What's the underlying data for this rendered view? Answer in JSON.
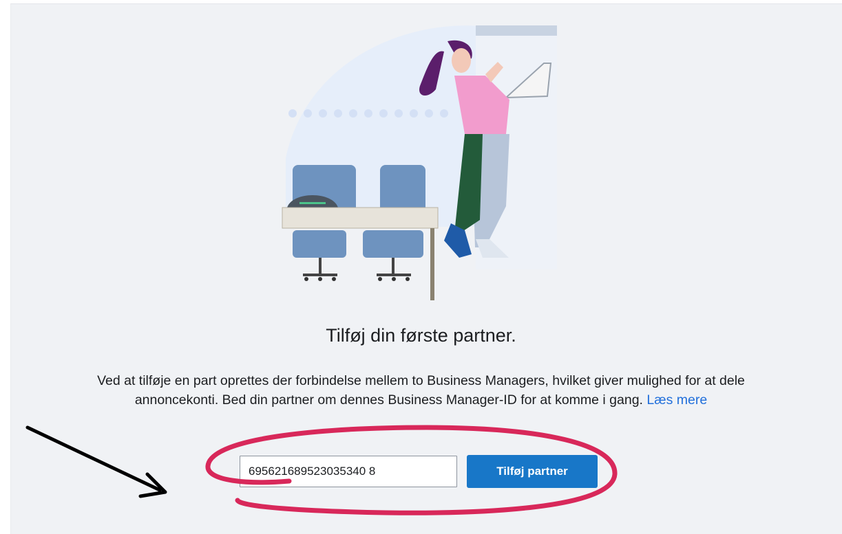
{
  "heading": "Tilføj din første partner.",
  "description": {
    "text": "Ved at tilføje en part oprettes der forbindelse mellem to Business Managers, hvilket giver mulighed for at dele annoncekonti. Bed din partner om dennes Business Manager-ID for at komme i gang.",
    "link_label": "Læs mere"
  },
  "partner_form": {
    "business_manager_id_value": "695621689523035340 8",
    "submit_label": "Tilføj partner"
  },
  "annotation": {
    "arrow_color": "#000000",
    "circle_color": "#d8285a"
  },
  "illustration_icon": "office-partner-illustration"
}
